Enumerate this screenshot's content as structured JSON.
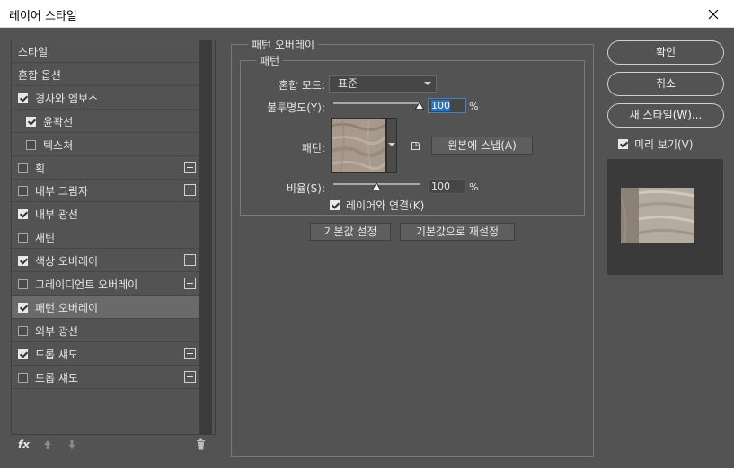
{
  "window": {
    "title": "레이어 스타일"
  },
  "styles_list": {
    "items": [
      {
        "label": "스타일",
        "has_checkbox": false,
        "checked": false,
        "has_plus": false,
        "selected": false,
        "indent": false
      },
      {
        "label": "혼합 옵션",
        "has_checkbox": false,
        "checked": false,
        "has_plus": false,
        "selected": false,
        "indent": false
      },
      {
        "label": "경사와 엠보스",
        "has_checkbox": true,
        "checked": true,
        "has_plus": false,
        "selected": false,
        "indent": false
      },
      {
        "label": "윤곽선",
        "has_checkbox": true,
        "checked": true,
        "has_plus": false,
        "selected": false,
        "indent": true
      },
      {
        "label": "텍스처",
        "has_checkbox": true,
        "checked": false,
        "has_plus": false,
        "selected": false,
        "indent": true
      },
      {
        "label": "획",
        "has_checkbox": true,
        "checked": false,
        "has_plus": true,
        "selected": false,
        "indent": false
      },
      {
        "label": "내부 그림자",
        "has_checkbox": true,
        "checked": false,
        "has_plus": true,
        "selected": false,
        "indent": false
      },
      {
        "label": "내부 광선",
        "has_checkbox": true,
        "checked": true,
        "has_plus": false,
        "selected": false,
        "indent": false
      },
      {
        "label": "새틴",
        "has_checkbox": true,
        "checked": false,
        "has_plus": false,
        "selected": false,
        "indent": false
      },
      {
        "label": "색상 오버레이",
        "has_checkbox": true,
        "checked": true,
        "has_plus": true,
        "selected": false,
        "indent": false
      },
      {
        "label": "그레이디언트 오버레이",
        "has_checkbox": true,
        "checked": false,
        "has_plus": true,
        "selected": false,
        "indent": false
      },
      {
        "label": "패턴 오버레이",
        "has_checkbox": true,
        "checked": true,
        "has_plus": false,
        "selected": true,
        "indent": false
      },
      {
        "label": "외부 광선",
        "has_checkbox": true,
        "checked": false,
        "has_plus": false,
        "selected": false,
        "indent": false
      },
      {
        "label": "드롭 섀도",
        "has_checkbox": true,
        "checked": true,
        "has_plus": true,
        "selected": false,
        "indent": false
      },
      {
        "label": "드롭 섀도",
        "has_checkbox": true,
        "checked": false,
        "has_plus": true,
        "selected": false,
        "indent": false
      }
    ],
    "bottom_icons": {
      "fx": "fx",
      "up": "arrow-up-icon",
      "down": "arrow-down-icon",
      "delete": "trash-icon"
    }
  },
  "pattern_overlay": {
    "section_title": "패턴 오버레이",
    "group_title": "패턴",
    "blend_mode_label": "혼합 모드:",
    "blend_mode_value": "표준",
    "opacity_label": "불투명도(Y):",
    "opacity_value": "100",
    "opacity_fraction": 1.0,
    "percent": "%",
    "pattern_label": "패턴:",
    "snap_button": "원본에 스냅(A)",
    "scale_label": "비율(S):",
    "scale_value": "100",
    "scale_fraction": 0.1,
    "link_label": "레이어와 연결(K)",
    "link_checked": true,
    "default_button": "기본값 설정",
    "reset_button": "기본값으로 재설정"
  },
  "actions": {
    "ok": "확인",
    "cancel": "취소",
    "new_style": "새 스타일(W)...",
    "preview_label": "미리 보기(V)",
    "preview_checked": true
  },
  "colors": {
    "panel_bg": "#535353",
    "swatch_base": "#a79a8c",
    "selection_blue": "#2a6ec8"
  }
}
